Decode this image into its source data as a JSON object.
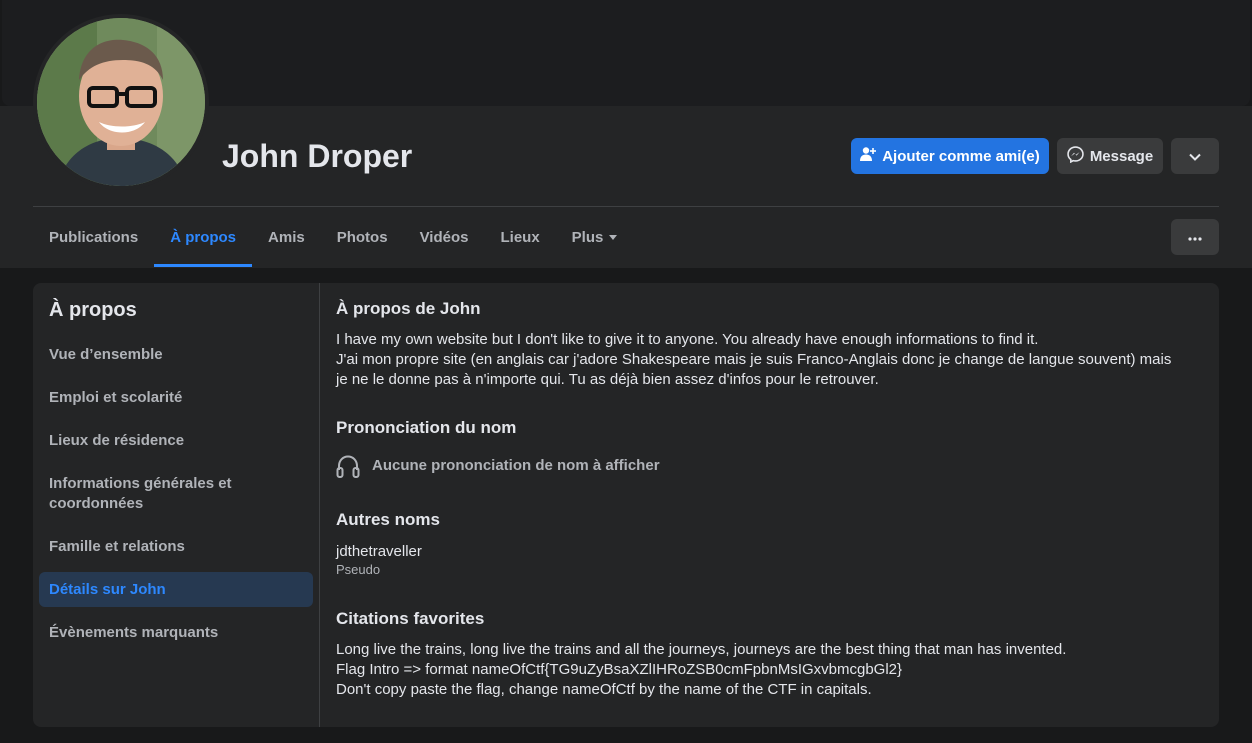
{
  "profile": {
    "name": "John Droper"
  },
  "actions": {
    "add_friend": "Ajouter comme ami(e)",
    "message": "Message"
  },
  "tabs": [
    {
      "label": "Publications"
    },
    {
      "label": "À propos"
    },
    {
      "label": "Amis"
    },
    {
      "label": "Photos"
    },
    {
      "label": "Vidéos"
    },
    {
      "label": "Lieux"
    },
    {
      "label": "Plus"
    }
  ],
  "sidebar": {
    "title": "À propos",
    "items": [
      {
        "label": "Vue d’ensemble"
      },
      {
        "label": "Emploi et scolarité"
      },
      {
        "label": "Lieux de résidence"
      },
      {
        "label": "Informations générales et coordonnées"
      },
      {
        "label": "Famille et relations"
      },
      {
        "label": "Détails sur John"
      },
      {
        "label": "Évènements marquants"
      }
    ]
  },
  "about": {
    "title": "À propos de John",
    "line1": "I have my own website but I don't like to give it to anyone. You already have enough informations to find it.",
    "line2": "J'ai mon propre site (en anglais car j'adore Shakespeare mais je suis Franco-Anglais donc je change de langue souvent) mais je ne le donne pas à n'importe qui. Tu as déjà bien assez d'infos pour le retrouver."
  },
  "pronunciation": {
    "title": "Prononciation du nom",
    "empty": "Aucune prononciation de nom à afficher"
  },
  "other_names": {
    "title": "Autres noms",
    "name": "jdthetraveller",
    "type": "Pseudo"
  },
  "quotes": {
    "title": "Citations favorites",
    "line1": "Long live the trains, long live the trains and all the journeys, journeys are the best thing that man has invented.",
    "line2": "Flag Intro => format nameOfCtf{TG9uZyBsaXZlIHRoZSB0cmFpbnMsIGxvbmcgbGl2}",
    "line3": "Don't copy paste the flag, change nameOfCtf by the name of the CTF in capitals."
  },
  "colors": {
    "accent": "#2d88ff",
    "primary_button": "#2374e1",
    "background": "#18191a",
    "surface": "#242526"
  }
}
